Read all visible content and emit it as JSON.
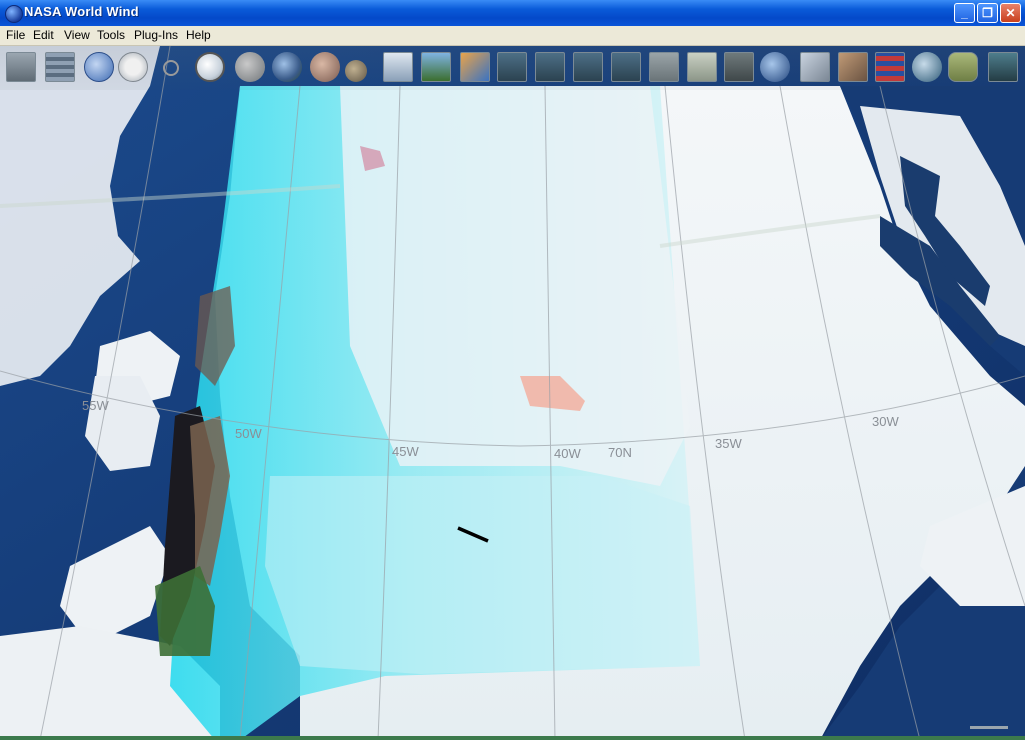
{
  "window": {
    "title": "NASA World Wind",
    "minimize_label": "_",
    "maximize_label": "❐",
    "close_label": "✕",
    "app_icon": "nasa-logo-icon"
  },
  "menu": {
    "items": [
      {
        "label": "File"
      },
      {
        "label": "Edit"
      },
      {
        "label": "View"
      },
      {
        "label": "Tools"
      },
      {
        "label": "Plug-Ins"
      },
      {
        "label": "Help"
      }
    ]
  },
  "toolbar": {
    "buttons": [
      {
        "icon": "layer-manager-icon"
      },
      {
        "icon": "grid-icon"
      },
      {
        "icon": "globe-grid-icon"
      },
      {
        "icon": "compass-icon"
      },
      {
        "icon": "crosshair-icon"
      },
      {
        "icon": "zoom-icon"
      },
      {
        "icon": "moon-globe-icon"
      },
      {
        "icon": "earth-globe-icon"
      },
      {
        "icon": "mars-globe-icon"
      },
      {
        "icon": "venus-globe-icon"
      },
      {
        "icon": "modis-layer-icon"
      },
      {
        "icon": "wms-layer-icon"
      },
      {
        "icon": "map-layer-icon"
      },
      {
        "icon": "landsat-layer-icon"
      },
      {
        "icon": "landsat-layer-icon"
      },
      {
        "icon": "landsat-layer-icon"
      },
      {
        "icon": "landsat-layer-icon"
      },
      {
        "icon": "topo-layer-icon"
      },
      {
        "icon": "topo-layer-icon"
      },
      {
        "icon": "usgs-layer-icon"
      },
      {
        "icon": "world-globe-icon"
      },
      {
        "icon": "image-layer-icon"
      },
      {
        "icon": "image-layer-icon"
      },
      {
        "icon": "flags-layer-icon"
      },
      {
        "icon": "placename-globe-icon"
      },
      {
        "icon": "usa-map-icon"
      },
      {
        "icon": "photo-layer-icon"
      }
    ]
  },
  "map": {
    "grid_labels": {
      "lon_55w": "55W",
      "lon_50w": "50W",
      "lon_45w": "45W",
      "lon_40w": "40W",
      "lat_70n": "70N",
      "lon_35w": "35W",
      "lon_30w": "30W"
    }
  },
  "colors": {
    "ocean": "#12386f",
    "ice": "#f2f5f7",
    "overlay": "#2fe0ef",
    "titlebar": "#0a5bd9",
    "menubar": "#ece9d8"
  }
}
